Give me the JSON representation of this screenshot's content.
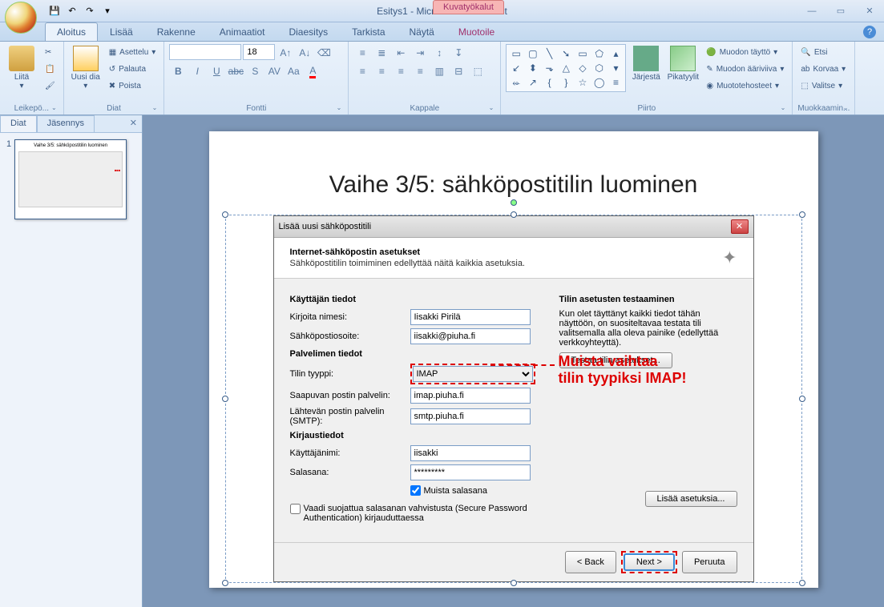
{
  "window": {
    "title": "Esitys1 - Microsoft PowerPoint",
    "contextual_tab": "Kuvatyökalut"
  },
  "tabs": {
    "t1": "Aloitus",
    "t2": "Lisää",
    "t3": "Rakenne",
    "t4": "Animaatiot",
    "t5": "Diaesitys",
    "t6": "Tarkista",
    "t7": "Näytä",
    "t8": "Muotoile"
  },
  "ribbon": {
    "clipboard": {
      "paste": "Liitä",
      "label": "Leikepö..."
    },
    "slides": {
      "newslide": "Uusi dia",
      "layout": "Asettelu",
      "reset": "Palauta",
      "delete": "Poista",
      "label": "Diat"
    },
    "font": {
      "size": "18",
      "label": "Fontti"
    },
    "paragraph": {
      "label": "Kappale"
    },
    "drawing": {
      "arrange": "Järjestä",
      "quick": "Pikatyylit",
      "fill": "Muodon täyttö",
      "outline": "Muodon ääriviiva",
      "effects": "Muototehosteet",
      "label": "Piirto"
    },
    "editing": {
      "find": "Etsi",
      "replace": "Korvaa",
      "select": "Valitse",
      "label": "Muokkaamin..."
    }
  },
  "panel": {
    "tab1": "Diat",
    "tab2": "Jäsennys",
    "thumb_num": "1",
    "thumb_title": "Vaihe 3/5: sähköpostitilin luominen"
  },
  "slide": {
    "title": "Vaihe 3/5: sähköpostitilin luominen",
    "callout1": "Muista vaihtaa",
    "callout2": "tilin tyypiksi IMAP!"
  },
  "dialog": {
    "title": "Lisää uusi sähköpostitili",
    "head_title": "Internet-sähköpostin asetukset",
    "head_sub": "Sähköpostitilin toimiminen edellyttää näitä kaikkia asetuksia.",
    "user_section": "Käyttäjän tiedot",
    "name_label": "Kirjoita nimesi:",
    "name_value": "Iisakki Pirilä",
    "email_label": "Sähköpostiosoite:",
    "email_value": "iisakki@piuha.fi",
    "server_section": "Palvelimen tiedot",
    "type_label": "Tilin tyyppi:",
    "type_value": "IMAP",
    "incoming_label": "Saapuvan postin palvelin:",
    "incoming_value": "imap.piuha.fi",
    "outgoing_label": "Lähtevän postin palvelin (SMTP):",
    "outgoing_value": "smtp.piuha.fi",
    "login_section": "Kirjaustiedot",
    "user_label": "Käyttäjänimi:",
    "user_value": "iisakki",
    "pass_label": "Salasana:",
    "pass_value": "*********",
    "remember": "Muista salasana",
    "spa": "Vaadi suojattua salasanan vahvistusta (Secure Password Authentication) kirjauduttaessa",
    "test_section": "Tilin asetusten testaaminen",
    "test_desc": "Kun olet täyttänyt kaikki tiedot tähän näyttöön, on suositeltavaa testata tili valitsemalla alla oleva painike (edellyttää verkkoyhteyttä).",
    "test_btn": "Testaa tilin asetukset...",
    "more_btn": "Lisää asetuksia...",
    "back": "< Back",
    "next": "Next >",
    "cancel": "Peruuta"
  }
}
